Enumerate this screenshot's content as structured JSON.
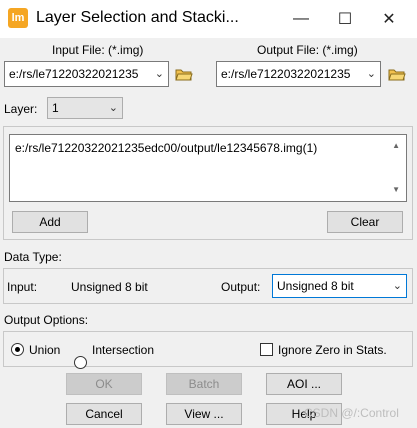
{
  "window": {
    "title": "Layer Selection and Stacki...",
    "app_icon_text": "lm",
    "minimize": "—",
    "maximize": "☐",
    "close": "✕"
  },
  "input_file": {
    "label": "Input File: (*.img)",
    "value": "e:/rs/le71220322021235"
  },
  "output_file": {
    "label": "Output File: (*.img)",
    "value": "e:/rs/le71220322021235"
  },
  "layer": {
    "label": "Layer:",
    "value": "1"
  },
  "layer_list": {
    "entry": "e:/rs/le71220322021235edc00/output/le12345678.img(1)"
  },
  "buttons": {
    "add": "Add",
    "clear": "Clear",
    "ok": "OK",
    "batch": "Batch",
    "aoi": "AOI ...",
    "cancel": "Cancel",
    "view": "View ...",
    "help": "Help"
  },
  "data_type": {
    "section_label": "Data Type:",
    "input_label": "Input:",
    "input_value": "Unsigned 8 bit",
    "output_label": "Output:",
    "output_value": "Unsigned 8 bit"
  },
  "output_options": {
    "section_label": "Output Options:",
    "union": "Union",
    "intersection": "Intersection",
    "ignore_zero": "Ignore Zero in Stats.",
    "union_selected": true,
    "ignore_zero_checked": false
  },
  "watermark": "CSDN @/:Control"
}
